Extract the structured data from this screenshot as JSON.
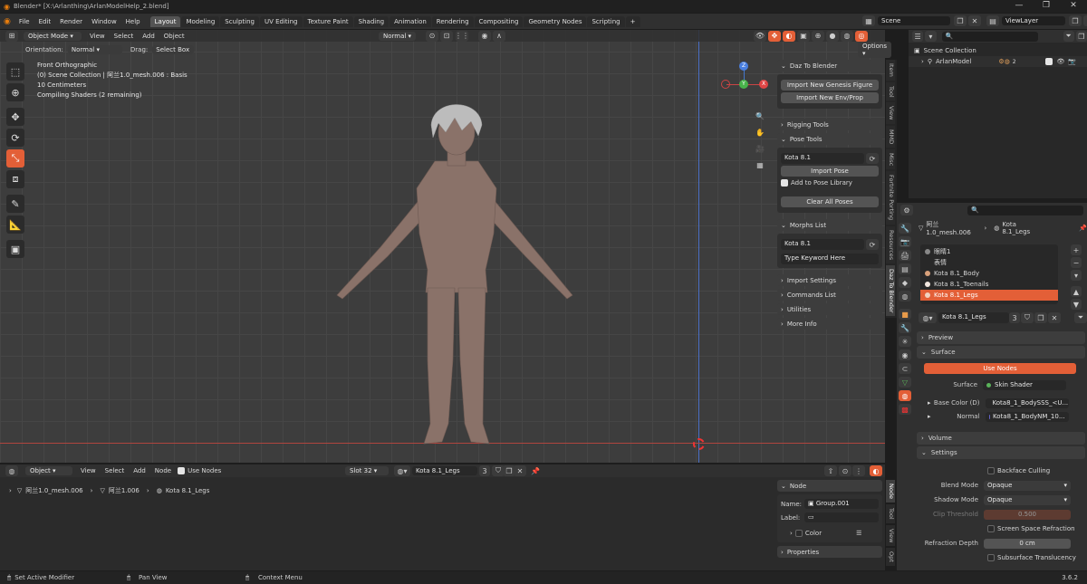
{
  "window": {
    "title": "Blender* [X:\\Arlanthing\\ArlanModelHelp_2.blend]",
    "controls": [
      "—",
      "❐",
      "✕"
    ]
  },
  "menu": [
    "File",
    "Edit",
    "Render",
    "Window",
    "Help"
  ],
  "workspaces": [
    "Layout",
    "Modeling",
    "Sculpting",
    "UV Editing",
    "Texture Paint",
    "Shading",
    "Animation",
    "Rendering",
    "Compositing",
    "Geometry Nodes",
    "Scripting"
  ],
  "workspace_add": "+",
  "scene": {
    "name": "Scene",
    "view_layer": "ViewLayer"
  },
  "viewport_header": {
    "mode": "Object Mode",
    "menus": [
      "View",
      "Select",
      "Add",
      "Object"
    ],
    "orientation_shading": "Normal"
  },
  "viewport_sub": {
    "orientation_label": "Orientation:",
    "orientation_value": "Normal",
    "drag_label": "Drag:",
    "drag_value": "Select Box",
    "options": "Options"
  },
  "viewport_info": [
    "Front Orthographic",
    "(0) Scene Collection | 阿兰1.0_mesh.006 : Basis",
    "10 Centimeters",
    "Compiling Shaders (2 remaining)"
  ],
  "gizmo": {
    "x": "X",
    "y": "Y",
    "z": "Z"
  },
  "npanel": {
    "daz_header": "Daz To Blender",
    "import_genesis": "Import New Genesis Figure",
    "import_env": "Import New Env/Prop",
    "rigging": "Rigging Tools",
    "pose_tools": "Pose Tools",
    "pose_select": "Kota 8.1",
    "import_pose": "Import Pose",
    "add_pose_library": "Add to Pose Library",
    "clear_poses": "Clear All Poses",
    "morphs": "Morphs List",
    "morph_select": "Kota 8.1",
    "keyword_placeholder": "Type Keyword Here",
    "import_settings": "Import Settings",
    "commands": "Commands List",
    "utilities": "Utilities",
    "more_info": "More Info"
  },
  "side_tabs": [
    "Item",
    "Tool",
    "View",
    "MMD",
    "Misc",
    "Fortnite Porting",
    "Resources",
    "Daz To Blender"
  ],
  "outliner": {
    "root": "Scene Collection",
    "item": "ArlanModel",
    "count": "2"
  },
  "properties": {
    "breadcrumb_object": "阿兰1.0_mesh.006",
    "breadcrumb_material": "Kota 8.1_Legs",
    "slots": [
      "眼睛1",
      "表情",
      "Kota 8.1_Body",
      "Kota 8.1_Toenails",
      "Kota 8.1_Legs"
    ],
    "material_name": "Kota 8.1_Legs",
    "material_users": "3",
    "preview": "Preview",
    "surface": "Surface",
    "use_nodes": "Use Nodes",
    "surface_label": "Surface",
    "surface_value": "Skin Shader",
    "base_color_label": "Base Color (D)",
    "base_color_value": "Kota8_1_BodySSS_<U...",
    "normal_label": "Normal",
    "normal_value": "Kota8_1_BodyNM_10...",
    "volume": "Volume",
    "settings": "Settings",
    "backface": "Backface Culling",
    "blend_mode_label": "Blend Mode",
    "blend_mode": "Opaque",
    "shadow_mode_label": "Shadow Mode",
    "shadow_mode": "Opaque",
    "clip_label": "Clip Threshold",
    "clip_value": "0.500",
    "ssr": "Screen Space Refraction",
    "refraction_label": "Refraction Depth",
    "refraction_value": "0 cm",
    "subsurface": "Subsurface Translucency"
  },
  "node_editor": {
    "type": "Object",
    "menus": [
      "View",
      "Select",
      "Add",
      "Node"
    ],
    "use_nodes": "Use Nodes",
    "slot": "Slot 32",
    "material": "Kota 8.1_Legs",
    "users": "3",
    "breadcrumb": [
      "阿兰1.0_mesh.006",
      "阿兰1.006",
      "Kota 8.1_Legs"
    ],
    "node_header": "Node",
    "name_label": "Name:",
    "name_value": "Group.001",
    "label_label": "Label:",
    "color": "Color",
    "properties": "Properties",
    "tabs": [
      "Node",
      "Tool",
      "View",
      "Opt"
    ]
  },
  "status": {
    "left": "Set Active Modifier",
    "middle": "Pan View",
    "right": "Context Menu",
    "version": "3.6.2"
  },
  "colors": {
    "accent": "#e35f37",
    "selected": "#e35f37",
    "header": "#303030",
    "viewport": "#3d3d3d"
  }
}
